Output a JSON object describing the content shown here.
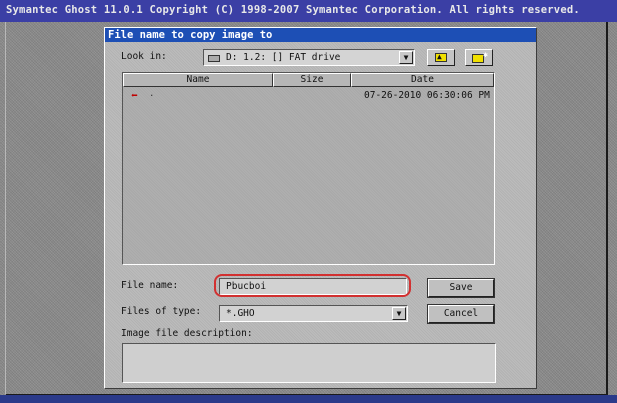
{
  "app": {
    "title": "Symantec Ghost 11.0.1   Copyright (C) 1998-2007 Symantec Corporation. All rights reserved."
  },
  "dialog": {
    "title": "File name to copy image to",
    "look_in_label": "Look in:",
    "look_in_value": "D: 1.2: [] FAT drive",
    "up_folder_icon": "up-one-level-icon",
    "new_folder_icon": "new-folder-icon",
    "columns": [
      "Name",
      "Size",
      "Date"
    ],
    "rows": [
      {
        "name": ".",
        "size": "",
        "date": "07-26-2010 06:30:06 PM",
        "icon": "parent-dir-arrow-icon"
      }
    ],
    "file_name_label": "File name:",
    "file_name_value": "Pbucboi",
    "files_of_type_label": "Files of type:",
    "files_of_type_value": "*.GHO",
    "description_label": "Image file description:",
    "description_value": "",
    "save_button": "Save",
    "cancel_button": "Cancel",
    "colors": {
      "title_bar": "#1d4fb5",
      "highlight_circle": "#d23030",
      "desktop_bar": "#3b3fa5"
    }
  }
}
